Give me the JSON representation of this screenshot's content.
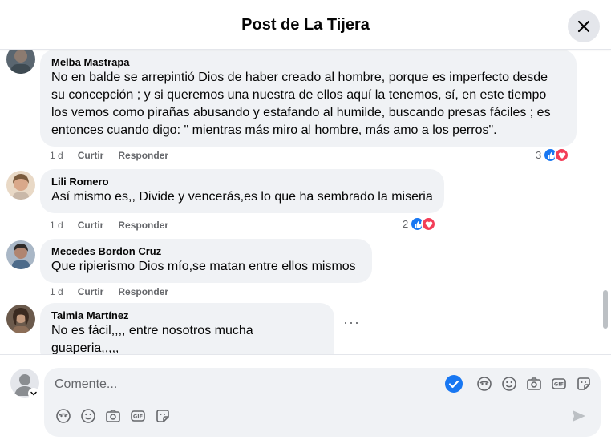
{
  "header": {
    "title": "Post de La Tijera"
  },
  "comments": [
    {
      "author": "Melba Mastrapa",
      "lines": [
        "No en balde se arrepintió Dios de haber creado al hombre, porque es imperfecto desde",
        "su concepción ; y si queremos una nuestra de ellos aquí la tenemos, sí, en este tiempo",
        "los vemos como pirañas abusando y estafando al humilde, buscando presas fáciles ; es",
        "entonces cuando digo: \" mientras más miro al hombre, más amo a los perros\"."
      ],
      "time": "1 d",
      "like": "Curtir",
      "reply": "Responder",
      "reactions": "3"
    },
    {
      "author": "Lili Romero",
      "lines": [
        "Así mismo es,, Divide y vencerás,es lo que ha sembrado la miseria"
      ],
      "time": "1 d",
      "like": "Curtir",
      "reply": "Responder",
      "reactions": "2"
    },
    {
      "author": "Mecedes Bordon Cruz",
      "lines": [
        "Que ripierismo Dios mío,se matan entre ellos mismos"
      ],
      "time": "1 d",
      "like": "Curtir",
      "reply": "Responder",
      "reactions": ""
    },
    {
      "author": "Taimia Martínez",
      "lines": [
        "No es fácil,,,, entre nosotros mucha guaperia,,,,,"
      ],
      "time": "",
      "like": "",
      "reply": "",
      "reactions": "",
      "more": "···"
    }
  ],
  "composer": {
    "placeholder": "Comente..."
  },
  "icons": {
    "close": "close-icon",
    "checkmark": "check-circle-icon",
    "avatar-sticker": "avatar-sticker-icon",
    "emoji": "emoji-icon",
    "camera": "camera-icon",
    "gif": "gif-icon",
    "sticker": "sticker-icon",
    "send": "send-icon"
  },
  "colors": {
    "like": "#1877f2",
    "love": "#f33e58",
    "check": "#1877f2"
  }
}
